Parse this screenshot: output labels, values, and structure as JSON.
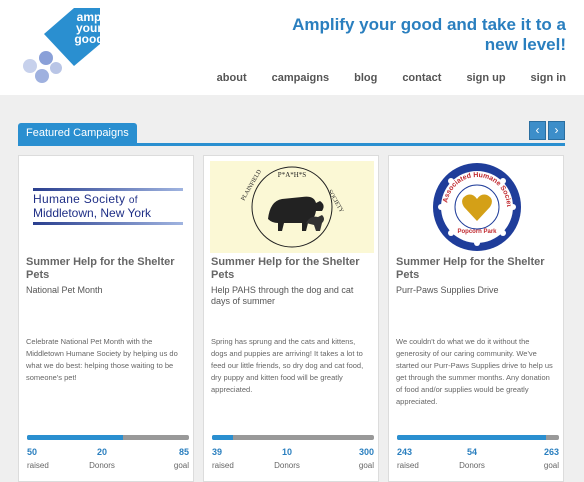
{
  "logo": {
    "text": "amp your good"
  },
  "header": {
    "tagline": "Amplify your good and take it to a new level!"
  },
  "nav": {
    "items": [
      "about",
      "campaigns",
      "blog",
      "contact",
      "sign up",
      "sign in"
    ]
  },
  "section": {
    "title": "Featured Campaigns",
    "prev_icon": "chevron-left-icon",
    "next_icon": "chevron-right-icon"
  },
  "cards": [
    {
      "image_text": "Humane Society of Middletown, New York",
      "title": "Summer Help for the Shelter Pets",
      "subtitle": "National Pet Month",
      "description": "Celebrate National Pet Month with the Middletown Humane Society by helping us do what we do best: helping those waiting to be someone's pet!",
      "progress": 0.59,
      "raised": "50",
      "donors": "20",
      "goal": "85",
      "labels": {
        "raised": "raised",
        "donors": "Donors",
        "goal": "goal"
      }
    },
    {
      "image_text": "P*A*H*S PLAINFIELD AREA HUMANE SOCIETY",
      "title": "Summer Help for the Shelter Pets",
      "subtitle": "Help PAHS through the dog and cat days of summer",
      "description": "Spring has sprung and the cats and kittens, dogs and puppies are arriving! It takes a lot to feed our little friends, so dry dog and cat food, dry puppy and kitten food will be greatly appreciated.",
      "progress": 0.13,
      "raised": "39",
      "donors": "10",
      "goal": "300",
      "labels": {
        "raised": "raised",
        "donors": "Donors",
        "goal": "goal"
      }
    },
    {
      "image_text": "Associated Humane Societies Popcorn Park",
      "title": "Summer Help for the Shelter Pets",
      "subtitle": "Purr-Paws Supplies Drive",
      "description": "We couldn't do what we do it without the generosity of our caring community. We've started our Purr-Paws Supplies drive to help us get through the summer months. Any donation of food and/or supplies would be greatly appreciated.",
      "progress": 0.92,
      "raised": "243",
      "donors": "54",
      "goal": "263",
      "labels": {
        "raised": "raised",
        "donors": "Donors",
        "goal": "goal"
      }
    }
  ],
  "colors": {
    "accent": "#2a8fd0",
    "title_blue": "#2a7fbf",
    "progress_bg": "#999999"
  }
}
